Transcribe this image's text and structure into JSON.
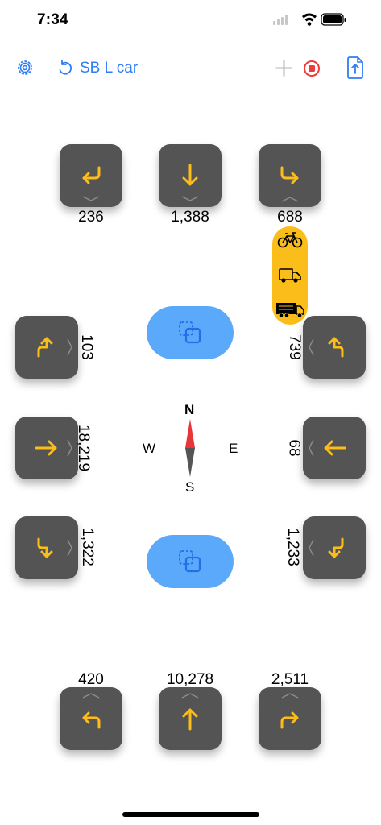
{
  "status_bar": {
    "time": "7:34"
  },
  "toolbar": {
    "title": "SB L car",
    "icons": [
      "gear-icon",
      "undo-icon",
      "plus-icon",
      "record-stop-icon",
      "export-icon"
    ],
    "accent_color": "#2f7cf6",
    "record_color": "#ef3b3b"
  },
  "counts": {
    "top_left": "236",
    "top_through": "1,388",
    "top_right": "688",
    "left_up": "103",
    "left_right": "18,219",
    "left_down": "1,322",
    "right_up": "739",
    "right_left": "68",
    "right_down": "1,233",
    "bottom_left": "420",
    "bottom_through": "10,278",
    "bottom_right": "2,511"
  },
  "compass": {
    "north": "N",
    "east": "E",
    "south": "S",
    "west": "W"
  },
  "vehicle_types": [
    "bicycle-icon",
    "van-icon",
    "truck-icon"
  ],
  "colors": {
    "arrow": "#fbbd1a",
    "tile": "#545454",
    "copy_button": "#5aa9fb"
  }
}
